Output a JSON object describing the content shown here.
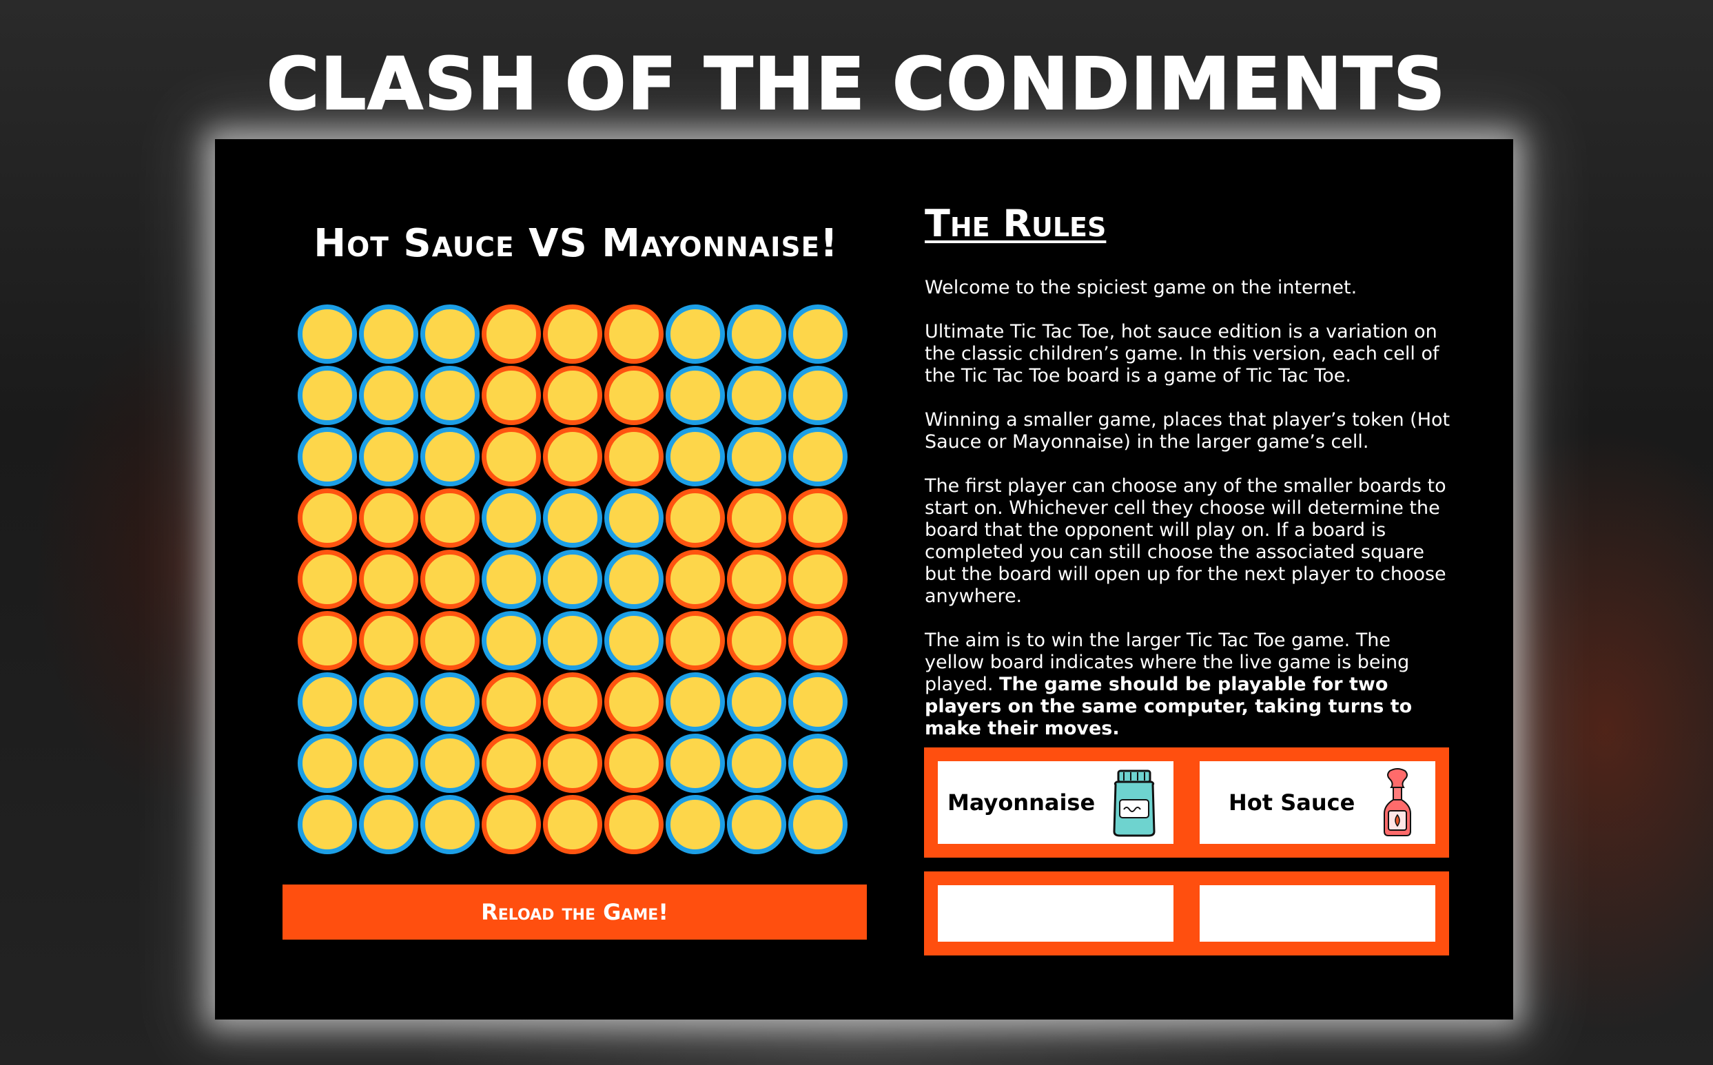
{
  "page": {
    "title": "CLASH OF THE CONDIMENTS"
  },
  "game": {
    "heading": "Hot Sauce VS Mayonnaise!",
    "reload_label": "Reload the Game!",
    "colors": {
      "token_fill": "#fdd64a",
      "ring_blue": "#1d9fe6",
      "ring_orange": "#ff5410",
      "accent": "#ff4f0f"
    },
    "board_rings": [
      [
        "blue",
        "blue",
        "blue",
        "orange",
        "orange",
        "orange",
        "blue",
        "blue",
        "blue"
      ],
      [
        "blue",
        "blue",
        "blue",
        "orange",
        "orange",
        "orange",
        "blue",
        "blue",
        "blue"
      ],
      [
        "blue",
        "blue",
        "blue",
        "orange",
        "orange",
        "orange",
        "blue",
        "blue",
        "blue"
      ],
      [
        "orange",
        "orange",
        "orange",
        "blue",
        "blue",
        "blue",
        "orange",
        "orange",
        "orange"
      ],
      [
        "orange",
        "orange",
        "orange",
        "blue",
        "blue",
        "blue",
        "orange",
        "orange",
        "orange"
      ],
      [
        "orange",
        "orange",
        "orange",
        "blue",
        "blue",
        "blue",
        "orange",
        "orange",
        "orange"
      ],
      [
        "blue",
        "blue",
        "blue",
        "orange",
        "orange",
        "orange",
        "blue",
        "blue",
        "blue"
      ],
      [
        "blue",
        "blue",
        "blue",
        "orange",
        "orange",
        "orange",
        "blue",
        "blue",
        "blue"
      ],
      [
        "blue",
        "blue",
        "blue",
        "orange",
        "orange",
        "orange",
        "blue",
        "blue",
        "blue"
      ]
    ]
  },
  "rules": {
    "heading": "The Rules",
    "p1": "Welcome to the spiciest game on the internet.",
    "p2": "Ultimate Tic Tac Toe, hot sauce edition is a variation on the classic children’s game. In this version, each cell of the Tic Tac Toe board is a game of Tic Tac Toe.",
    "p3": "Winning a smaller game, places that player’s token (Hot Sauce or Mayonnaise) in the larger game’s cell.",
    "p4": "The first player can choose any of the smaller boards to start on. Whichever cell they choose will determine the board that the opponent will play on. If a board is completed you can still choose the associated square but the board will open up for the next player to choose anywhere.",
    "p5_normal": "The aim is to win the larger Tic Tac Toe game. The yellow board indicates where the live game is being played. ",
    "p5_bold": "The game should be playable for two players on the same computer, taking turns to make their moves."
  },
  "players": {
    "left": {
      "label": "Mayonnaise",
      "icon": "mayonnaise-jar-icon"
    },
    "right": {
      "label": "Hot Sauce",
      "icon": "hot-sauce-bottle-icon"
    }
  },
  "scores": {
    "left": "",
    "right": ""
  }
}
